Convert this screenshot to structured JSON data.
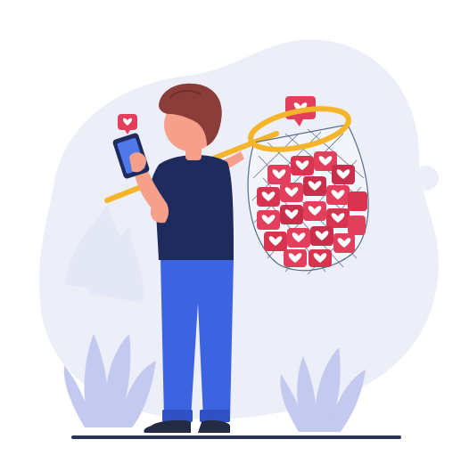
{
  "illustration": {
    "subject": "person-collecting-likes-with-net",
    "icons": [
      "heart-icon",
      "like-notification-icon",
      "smartphone-icon",
      "butterfly-net-icon"
    ]
  },
  "colors": {
    "background_blob": "#eceef8",
    "plant": "#c3c9ef",
    "ground": "#2c3354",
    "hair": "#8b3d3a",
    "skin": "#f6a08b",
    "shirt": "#1f2b5c",
    "jeans": "#3c63e0",
    "shoes": "#232a44",
    "net_ring": "#f5b52b",
    "heart_bubble": "#e23f5d",
    "heart_bubble_dark": "#b92846"
  }
}
